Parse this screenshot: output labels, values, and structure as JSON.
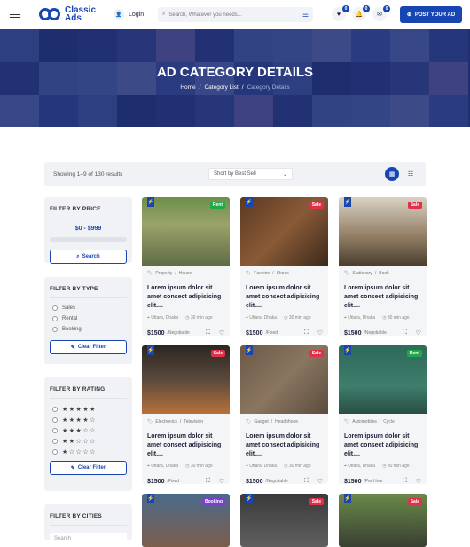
{
  "header": {
    "logo_line1": "Classic",
    "logo_line2": "Ads",
    "login": "Login",
    "search_placeholder": "Search, Whatever you needs...",
    "favorites_count": "0",
    "notifications_count": "0",
    "messages_count": "0",
    "post_button": "POST YOUR AD"
  },
  "hero": {
    "title": "AD CATEGORY DETAILS",
    "breadcrumb": [
      "Home",
      "Category List",
      "Category Details"
    ]
  },
  "results": {
    "showing": "Showing 1–9 of 130 results",
    "sort_selected": "Short by Best Sell"
  },
  "filters": {
    "price": {
      "title": "FILTER BY PRICE",
      "range": "$0 - $999",
      "button": "Search"
    },
    "type": {
      "title": "FILTER BY TYPE",
      "options": [
        "Sales",
        "Rental",
        "Booking"
      ],
      "button": "Clear Filter"
    },
    "rating": {
      "title": "FILTER BY RATING",
      "ratings": [
        5,
        4,
        3,
        2,
        1
      ],
      "button": "Clear Filter"
    },
    "cities": {
      "title": "FILTER BY CITIES",
      "placeholder": "Search"
    }
  },
  "listings": [
    {
      "badge": "Rent",
      "badge_color": "#1fa94a",
      "category": "Property",
      "sub": "House",
      "title": "Lorem ipsum dolor sit amet consect adipisicing elit....",
      "location": "Uttara, Dhaka",
      "time": "30 min ago",
      "price": "$1500",
      "price_note": "/Negotiable"
    },
    {
      "badge": "Sale",
      "badge_color": "#e0304a",
      "category": "Fashion",
      "sub": "Shoes",
      "title": "Lorem ipsum dolor sit amet consect adipisicing elit....",
      "location": "Uttara, Dhaka",
      "time": "30 min ago",
      "price": "$1500",
      "price_note": "/Fixed"
    },
    {
      "badge": "Sale",
      "badge_color": "#e0304a",
      "category": "Stationary",
      "sub": "Book",
      "title": "Lorem ipsum dolor sit amet consect adipisicing elit....",
      "location": "Uttara, Dhaka",
      "time": "30 min ago",
      "price": "$1500",
      "price_note": "/Negotiable"
    },
    {
      "badge": "Sale",
      "badge_color": "#e0304a",
      "category": "Electronics",
      "sub": "Television",
      "title": "Lorem ipsum dolor sit amet consect adipisicing elit....",
      "location": "Uttara, Dhaka",
      "time": "30 min ago",
      "price": "$1500",
      "price_note": "/Fixed"
    },
    {
      "badge": "Sale",
      "badge_color": "#e0304a",
      "category": "Gadget",
      "sub": "Headphone",
      "title": "Lorem ipsum dolor sit amet consect adipisicing elit....",
      "location": "Uttara, Dhaka",
      "time": "30 min ago",
      "price": "$1500",
      "price_note": "/Negotiable"
    },
    {
      "badge": "Rent",
      "badge_color": "#1fa94a",
      "category": "Automobiles",
      "sub": "Cycle",
      "title": "Lorem ipsum dolor sit amet consect adipisicing elit....",
      "location": "Uttara, Dhaka",
      "time": "30 min ago",
      "price": "$1500",
      "price_note": "/Per Hour"
    },
    {
      "badge": "Booking",
      "badge_color": "#7a3fd0"
    },
    {
      "badge": "Sale",
      "badge_color": "#e0304a"
    },
    {
      "badge": "Sale",
      "badge_color": "#e0304a"
    }
  ],
  "colors": {
    "primary": "#1746b3",
    "sale": "#e0304a",
    "rent": "#1fa94a",
    "booking": "#7a3fd0"
  }
}
